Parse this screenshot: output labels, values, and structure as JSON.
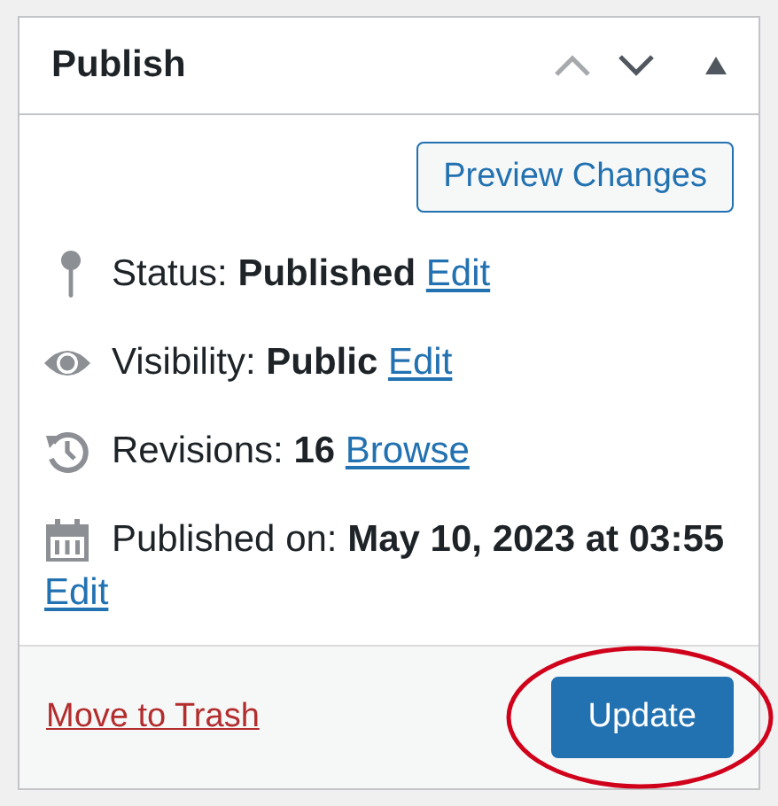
{
  "panel": {
    "title": "Publish",
    "move_up_disabled": true
  },
  "preview_button": "Preview Changes",
  "rows": [
    {
      "kind": "status",
      "label": "Status: ",
      "value": "Published",
      "link": "Edit"
    },
    {
      "kind": "visibility",
      "label": "Visibility: ",
      "value": "Public",
      "link": "Edit"
    },
    {
      "kind": "revisions",
      "label": "Revisions: ",
      "value": "16",
      "link": "Browse"
    },
    {
      "kind": "date",
      "label": "Published on: ",
      "value": "May 10, 2023 at 03:55",
      "link": "Edit"
    }
  ],
  "footer": {
    "trash_link": "Move to Trash",
    "update_button": "Update",
    "update_circled": true
  }
}
